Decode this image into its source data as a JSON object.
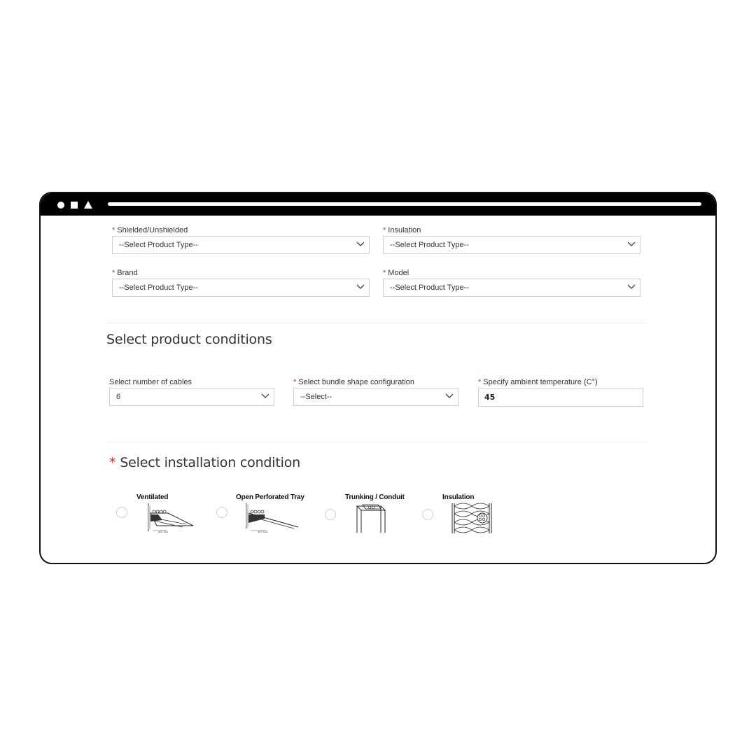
{
  "product_fields": {
    "shielded": {
      "label": "Shielded/Unshielded",
      "value": "--Select Product Type--"
    },
    "insulation": {
      "label": "Insulation",
      "value": "--Select Product Type--"
    },
    "brand": {
      "label": "Brand",
      "value": "--Select Product Type--"
    },
    "model": {
      "label": "Model",
      "value": "--Select Product Type--"
    }
  },
  "conditions": {
    "title": "Select product conditions",
    "cables": {
      "label": "Select number of cables",
      "value": "6"
    },
    "bundle": {
      "label": "Select bundle shape configuration",
      "value": "--Select--"
    },
    "temperature": {
      "label": "Specify ambient temperature (C°)",
      "value": "45"
    }
  },
  "installation": {
    "title": "Select installation condition",
    "options": [
      {
        "label": "Ventilated",
        "icon": "ventilated-tray-icon"
      },
      {
        "label": "Open Perforated Tray",
        "icon": "perforated-tray-icon"
      },
      {
        "label": "Trunking / Conduit",
        "icon": "trunking-conduit-icon"
      },
      {
        "label": "Insulation",
        "icon": "insulation-icon"
      }
    ]
  },
  "required_marker": "*",
  "colors": {
    "required": "#e0261b",
    "frame": "#000000",
    "border": "#cfcfcf"
  }
}
